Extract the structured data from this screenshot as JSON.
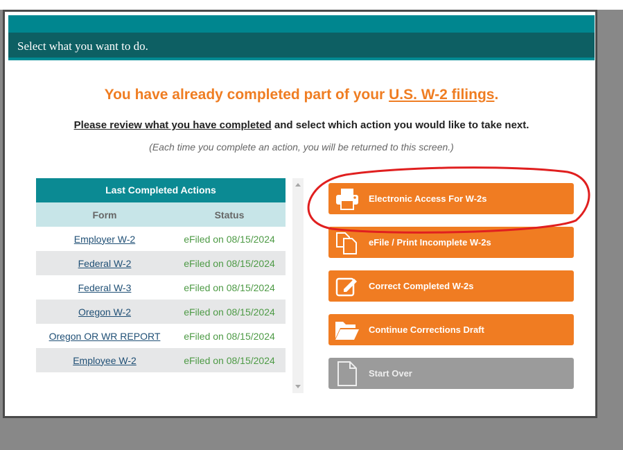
{
  "dialog": {
    "title": "Select what you want to do.",
    "headline_prefix": "You have already completed part of your",
    "headline_link": "U.S. W-2 filings",
    "headline_suffix": ".",
    "sub_underlined": "Please review what you have completed",
    "sub_rest": " and select which action you would like to take next.",
    "note": "(Each time you complete an action, you will be returned to this screen.)"
  },
  "table": {
    "title": "Last Completed Actions",
    "columns": [
      "Form",
      "Status"
    ],
    "rows": [
      {
        "form": "Employer W-2",
        "status": "eFiled on 08/15/2024"
      },
      {
        "form": "Federal W-2",
        "status": "eFiled on 08/15/2024"
      },
      {
        "form": "Federal W-3",
        "status": "eFiled on 08/15/2024"
      },
      {
        "form": "Oregon W-2",
        "status": "eFiled on 08/15/2024"
      },
      {
        "form": "Oregon OR WR REPORT",
        "status": "eFiled on 08/15/2024"
      },
      {
        "form": "Employee W-2",
        "status": "eFiled on 08/15/2024"
      }
    ]
  },
  "actions": [
    {
      "label": "Electronic Access For W-2s",
      "icon": "printer-icon",
      "enabled": true
    },
    {
      "label": "eFile / Print Incomplete W-2s",
      "icon": "copy-documents-icon",
      "enabled": true
    },
    {
      "label": "Correct Completed W-2s",
      "icon": "edit-icon",
      "enabled": true
    },
    {
      "label": "Continue Corrections Draft",
      "icon": "folder-open-icon",
      "enabled": true
    },
    {
      "label": "Start Over",
      "icon": "blank-document-icon",
      "enabled": false
    }
  ],
  "colors": {
    "accent": "#f07c22",
    "teal": "#0b8a93",
    "title_bar": "#0d5f63",
    "status_green": "#4d9a45",
    "annotation_red": "#e01f1f"
  }
}
